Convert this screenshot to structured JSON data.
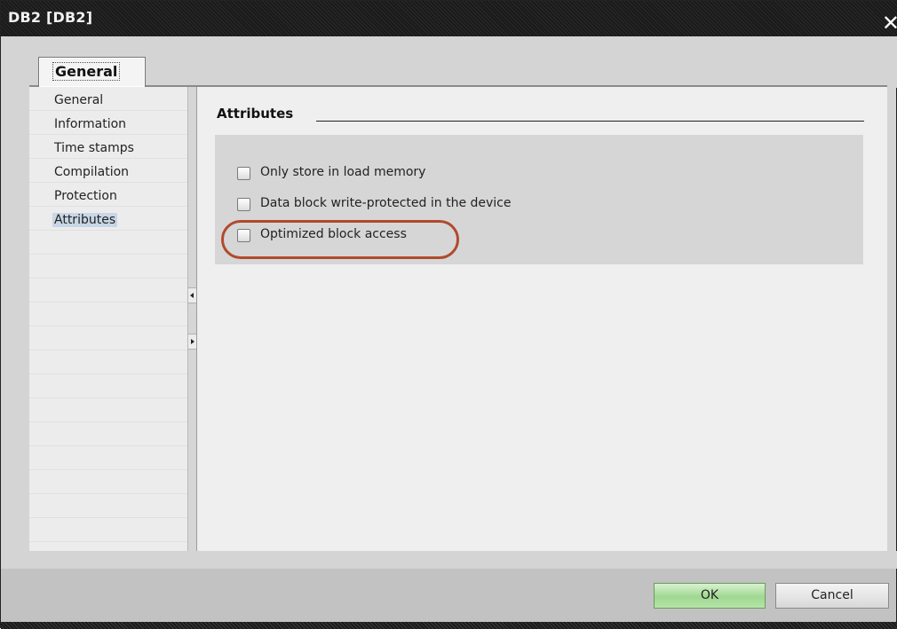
{
  "window": {
    "title": "DB2 [DB2]",
    "close_glyph": "✕"
  },
  "tabs": [
    {
      "label": "General",
      "active": true
    }
  ],
  "nav": {
    "items": [
      {
        "label": "General",
        "selected": false
      },
      {
        "label": "Information",
        "selected": false
      },
      {
        "label": "Time stamps",
        "selected": false
      },
      {
        "label": "Compilation",
        "selected": false
      },
      {
        "label": "Protection",
        "selected": false
      },
      {
        "label": "Attributes",
        "selected": true
      }
    ]
  },
  "attributes": {
    "title": "Attributes",
    "options": [
      {
        "label": "Only store in load memory",
        "checked": false
      },
      {
        "label": "Data block write-protected in the device",
        "checked": false
      },
      {
        "label": "Optimized block access",
        "checked": false
      }
    ]
  },
  "buttons": {
    "ok": "OK",
    "cancel": "Cancel"
  },
  "colors": {
    "highlight_ring": "#b14a2c",
    "ok_button": "#9fd890",
    "selected_nav": "#c8d6e6"
  }
}
